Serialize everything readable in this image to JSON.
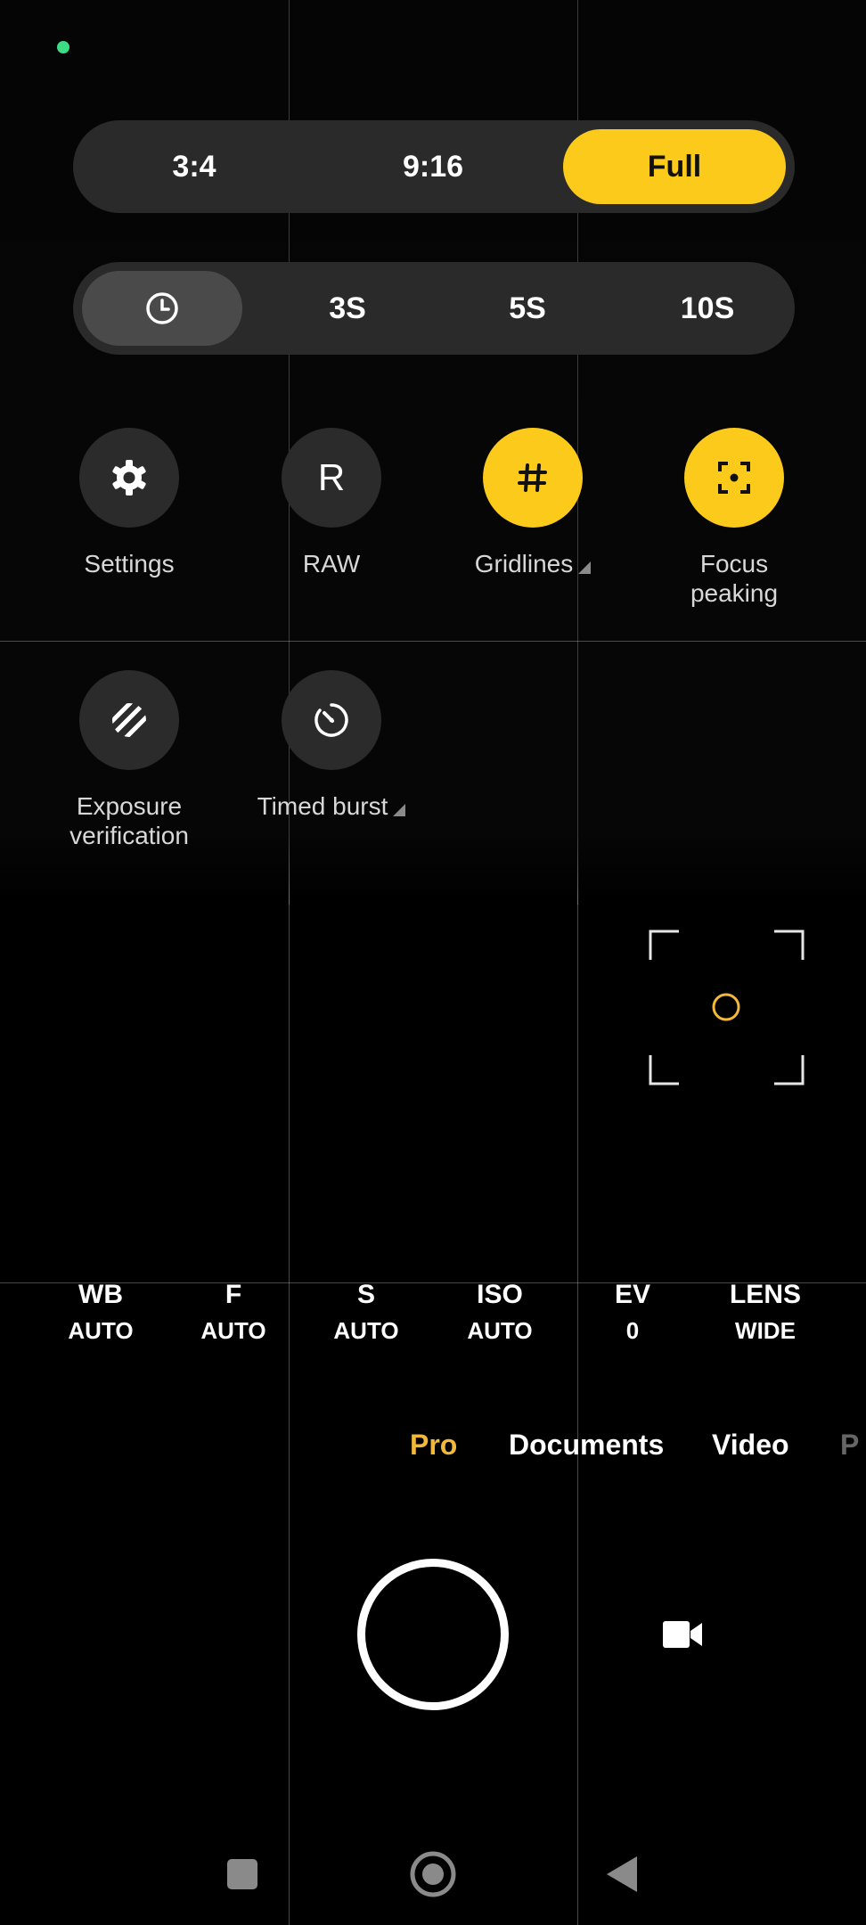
{
  "aspect_ratio": {
    "options": [
      "3:4",
      "9:16",
      "Full"
    ],
    "selected": "Full"
  },
  "timer": {
    "options": [
      "3S",
      "5S",
      "10S"
    ],
    "selected": "off"
  },
  "quick_settings": [
    {
      "label": "Settings",
      "icon": "gear-icon",
      "active": false
    },
    {
      "label": "RAW",
      "icon": "raw-letter-icon",
      "glyph": "R",
      "active": false
    },
    {
      "label": "Gridlines",
      "icon": "grid-hash-icon",
      "active": true,
      "has_submenu": true
    },
    {
      "label": "Focus\npeaking",
      "icon": "focus-peaking-icon",
      "active": true
    },
    {
      "label": "Exposure\nverification",
      "icon": "zebra-stripes-icon",
      "active": false
    },
    {
      "label": "Timed burst",
      "icon": "timed-burst-icon",
      "active": false,
      "has_submenu": true
    }
  ],
  "pro_params": [
    {
      "key": "WB",
      "value": "AUTO"
    },
    {
      "key": "F",
      "value": "AUTO"
    },
    {
      "key": "S",
      "value": "AUTO"
    },
    {
      "key": "ISO",
      "value": "AUTO"
    },
    {
      "key": "EV",
      "value": "0"
    },
    {
      "key": "LENS",
      "value": "WIDE"
    }
  ],
  "modes": [
    {
      "label": "Pro",
      "active": true
    },
    {
      "label": "Documents",
      "active": false
    },
    {
      "label": "Video",
      "active": false
    },
    {
      "label": "P",
      "active": false
    }
  ],
  "colors": {
    "accent": "#fcca1a",
    "mode_active": "#f2b83a",
    "status_dot": "#3ddc84"
  },
  "nav": {
    "recent": "square-icon",
    "home": "circle-icon",
    "back": "triangle-back-icon"
  }
}
